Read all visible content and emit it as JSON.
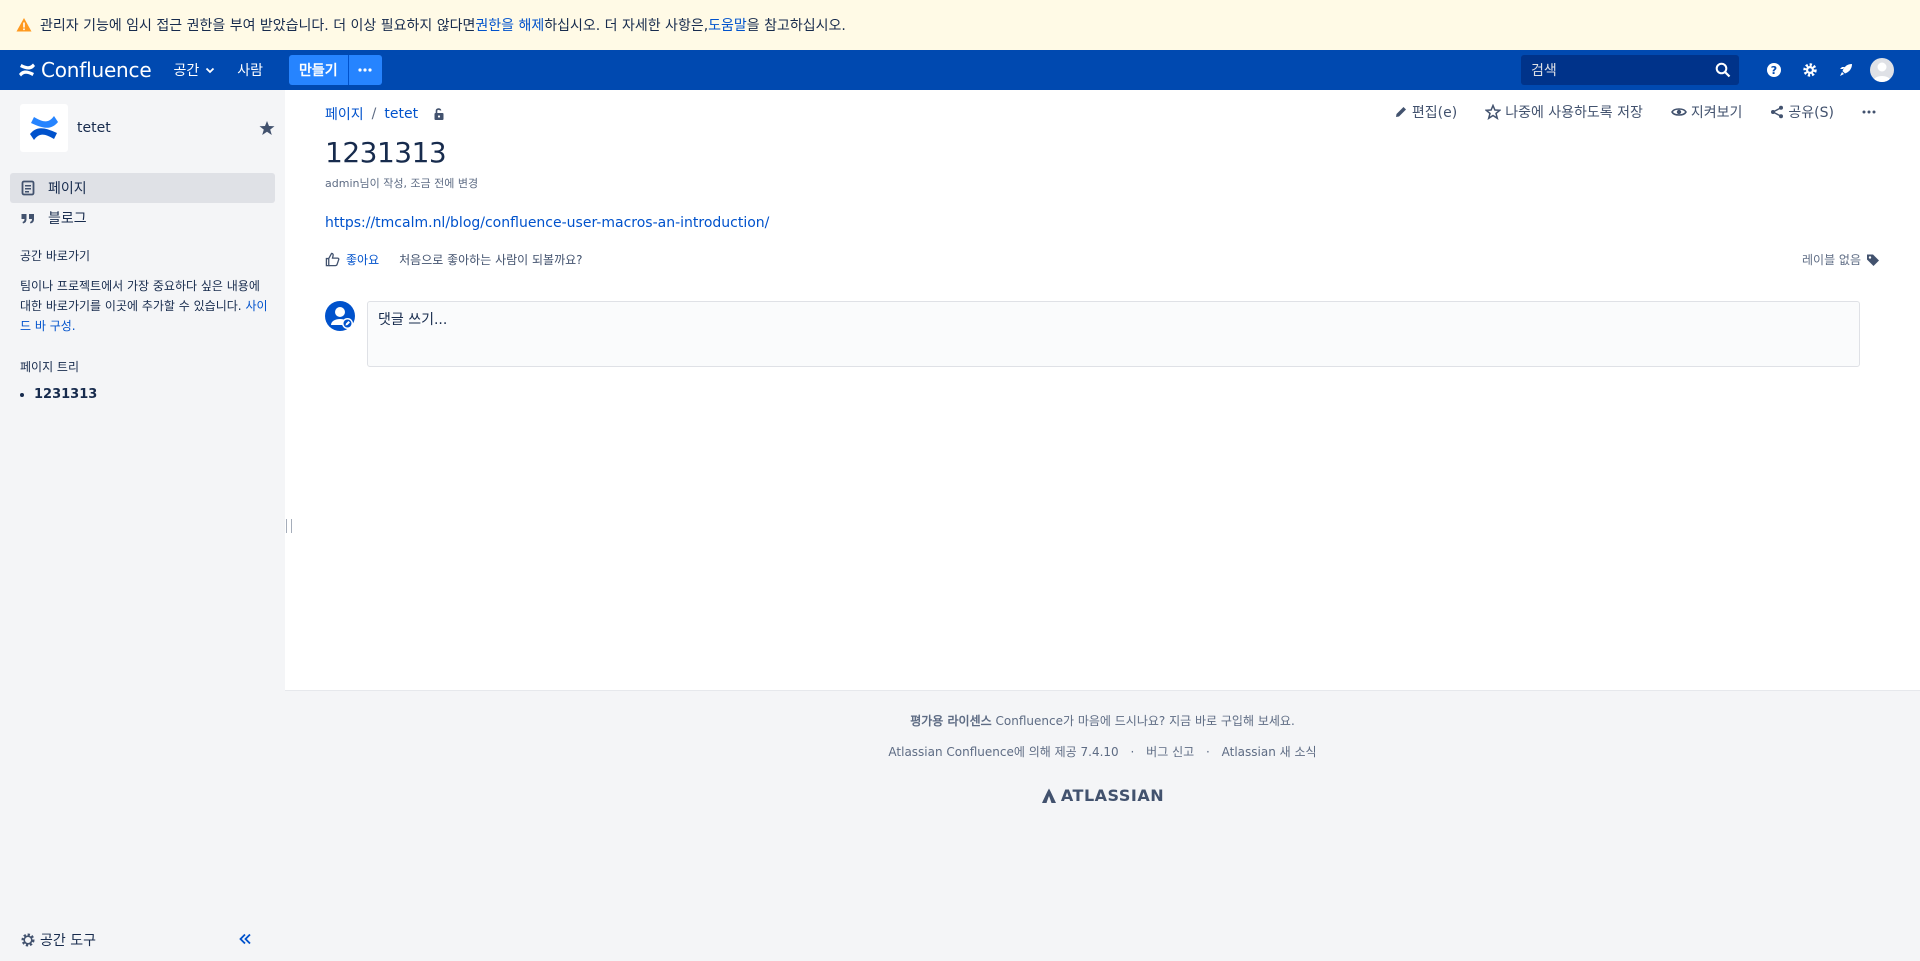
{
  "banner": {
    "text_1": "관리자 기능에 임시 접근 권한을 부여 받았습니다. 더 이상 필요하지 않다면 ",
    "link_revoke": "권한을 해제",
    "text_2": "하십시오. 더 자세한 사항은, ",
    "link_help": "도움말",
    "text_3": "을 참고하십시오.",
    "icon": "warning-icon",
    "color": "#fffae6"
  },
  "topnav": {
    "brand": "Confluence",
    "spaces": "공간",
    "people": "사람",
    "create": "만들기",
    "search_placeholder": "검색",
    "color": "#0049b0"
  },
  "sidebar": {
    "space_name": "tetet",
    "items": [
      {
        "label": "페이지",
        "icon": "page-icon"
      },
      {
        "label": "블로그",
        "icon": "quote-icon"
      }
    ],
    "shortcuts_heading": "공간 바로가기",
    "shortcuts_text": "팀이나 프로젝트에서 가장 중요하다 싶은 내용에 대한 바로가기를 이곳에 추가할 수 있습니다. ",
    "shortcuts_link": "사이드 바 구성.",
    "tree_heading": "페이지 트리",
    "tree_items": [
      "1231313"
    ],
    "space_tools": "공간 도구"
  },
  "page": {
    "breadcrumb": [
      "페이지",
      "tetet"
    ],
    "actions": {
      "edit": "편집(e)",
      "save_later": "나중에 사용하도록 저장",
      "watch": "지켜보기",
      "share": "공유(S)"
    },
    "title": "1231313",
    "byline": "admin님이 작성, 조금 전에 변경",
    "link": "https://tmcalm.nl/blog/confluence-user-macros-an-introduction/",
    "like": "좋아요",
    "like_prompt": "처음으로 좋아하는 사람이 되볼까요?",
    "labels": "레이블 없음",
    "comment_placeholder": "댓글 쓰기..."
  },
  "footer": {
    "license_bold": "평가용 라이센스",
    "license_text": " Confluence가 마음에 드시나요? 지금 바로 구입해 보세요.",
    "powered": "Atlassian Confluence에 의해 제공 7.4.10",
    "bug": "버그 신고",
    "news": "Atlassian 새 소식",
    "logo": "ATLASSIAN"
  },
  "colors": {
    "link": "#0052cc",
    "text": "#172b4d",
    "sidebar_bg": "#f4f5f7"
  }
}
